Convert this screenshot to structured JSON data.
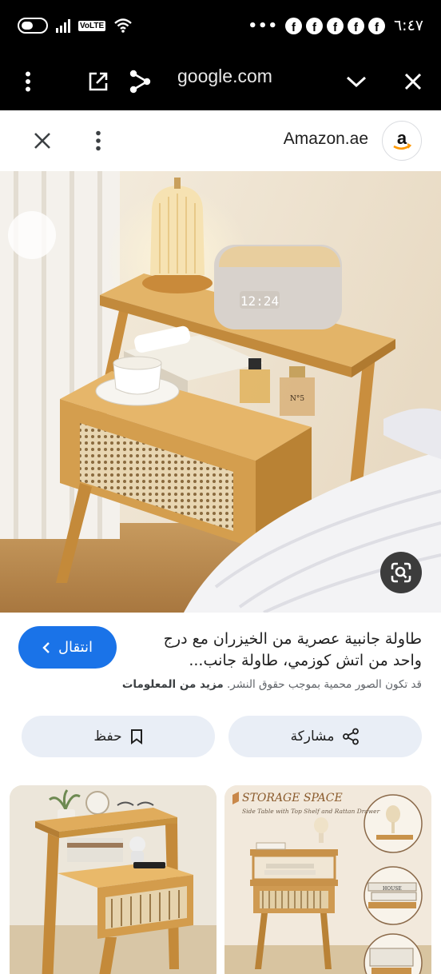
{
  "status_bar": {
    "time": "٦:٤٧",
    "network_badge": "VoLTE",
    "more_indicator": "•••",
    "notification_icons": [
      "facebook-icon",
      "facebook-icon",
      "facebook-icon",
      "facebook-icon",
      "facebook-icon"
    ],
    "notification_glyph": "f"
  },
  "url_bar": {
    "url": "google.com",
    "icons": [
      "more-vert-icon",
      "open-external-icon",
      "share-icon",
      "chevron-down-icon",
      "close-icon"
    ]
  },
  "source": {
    "name": "Amazon.ae",
    "logo_letter": "a",
    "icons": [
      "close-icon",
      "more-vert-icon"
    ]
  },
  "hero": {
    "lens_icon": "lens-search-icon",
    "clock_display": "12:24",
    "perfume_label": "N°5"
  },
  "info": {
    "title": "طاولة جانبية عصرية من الخيزران مع درج واحد من اتش كوزمي، طاولة جانب...",
    "visit_label": "انتقال",
    "notice_text": "قد تكون الصور محمية بموجب حقوق النشر.",
    "notice_link": "مزيد من المعلومات"
  },
  "actions": {
    "share_label": "مشاركة",
    "save_label": "حفظ"
  },
  "related": {
    "thumb2_title": "STORAGE SPACE",
    "thumb2_subtitle": "Side Table with Top Shelf and Rattan Drawer",
    "thumb2_book_label": "HOUSE"
  },
  "colors": {
    "accent": "#1a73e8",
    "chip_bg": "#e9eef6",
    "bar_bg": "#000000",
    "wood": "#d9a552"
  }
}
